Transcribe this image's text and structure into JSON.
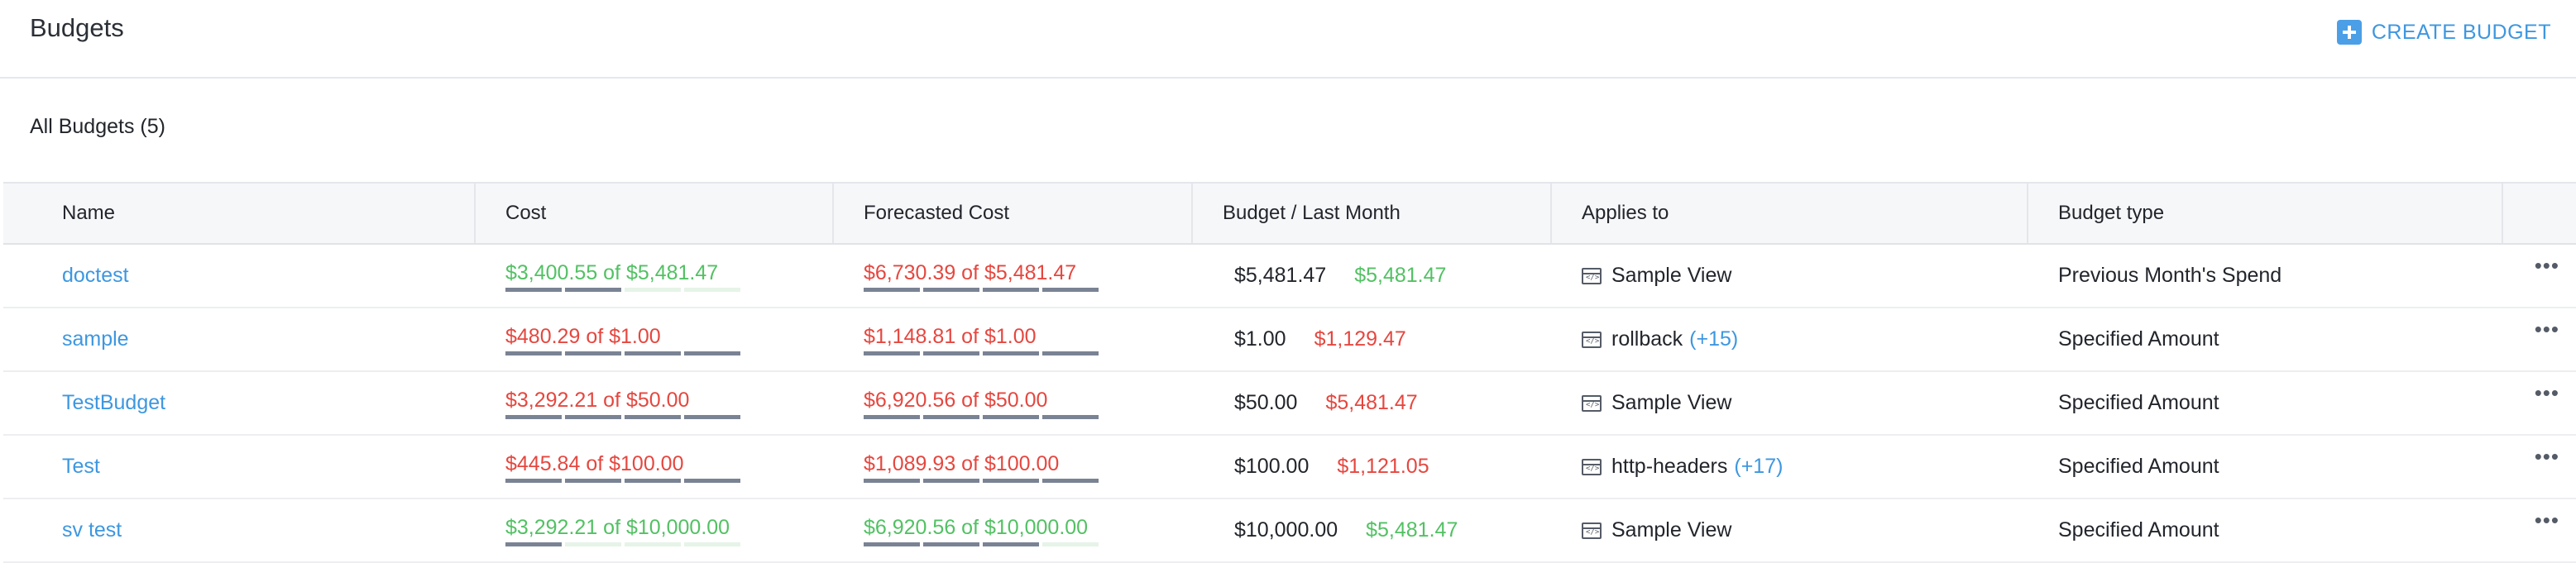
{
  "header": {
    "title": "Budgets",
    "create_label": "CREATE BUDGET"
  },
  "section": {
    "title": "All Budgets (5)"
  },
  "columns": [
    "Name",
    "Cost",
    "Forecasted Cost",
    "Budget / Last Month",
    "Applies to",
    "Budget type"
  ],
  "colors": {
    "accent": "#3d97e0",
    "ok": "#52c163",
    "over": "#e5473f",
    "bar": "#7a8394"
  },
  "rows": [
    {
      "name": "doctest",
      "cost": "$3,400.55 of $5,481.47",
      "cost_status": "green",
      "cost_fraction": 0.62,
      "forecast": "$6,730.39 of $5,481.47",
      "forecast_status": "red",
      "forecast_fraction": 1.23,
      "budget": "$5,481.47",
      "last_month": "$5,481.47",
      "last_status": "green",
      "applies": "Sample View",
      "applies_extra": "",
      "type": "Previous Month's Spend"
    },
    {
      "name": "sample",
      "cost": "$480.29 of $1.00",
      "cost_status": "red",
      "cost_fraction": 1.0,
      "forecast": "$1,148.81 of $1.00",
      "forecast_status": "red",
      "forecast_fraction": 1.0,
      "budget": "$1.00",
      "last_month": "$1,129.47",
      "last_status": "red",
      "applies": "rollback",
      "applies_extra": "(+15)",
      "type": "Specified Amount"
    },
    {
      "name": "TestBudget",
      "cost": "$3,292.21 of $50.00",
      "cost_status": "red",
      "cost_fraction": 1.0,
      "forecast": "$6,920.56 of $50.00",
      "forecast_status": "red",
      "forecast_fraction": 1.0,
      "budget": "$50.00",
      "last_month": "$5,481.47",
      "last_status": "red",
      "applies": "Sample View",
      "applies_extra": "",
      "type": "Specified Amount"
    },
    {
      "name": "Test",
      "cost": "$445.84 of $100.00",
      "cost_status": "red",
      "cost_fraction": 1.0,
      "forecast": "$1,089.93 of $100.00",
      "forecast_status": "red",
      "forecast_fraction": 1.0,
      "budget": "$100.00",
      "last_month": "$1,121.05",
      "last_status": "red",
      "applies": "http-headers",
      "applies_extra": "(+17)",
      "type": "Specified Amount"
    },
    {
      "name": "sv test",
      "cost": "$3,292.21 of $10,000.00",
      "cost_status": "green",
      "cost_fraction": 0.33,
      "forecast": "$6,920.56 of $10,000.00",
      "forecast_status": "green",
      "forecast_fraction": 0.69,
      "budget": "$10,000.00",
      "last_month": "$5,481.47",
      "last_status": "green",
      "applies": "Sample View",
      "applies_extra": "",
      "type": "Specified Amount"
    }
  ],
  "icons": {
    "create": "plus-square-icon",
    "view": "code-window-icon",
    "more": "more-dots-icon"
  },
  "more_label": "•••"
}
